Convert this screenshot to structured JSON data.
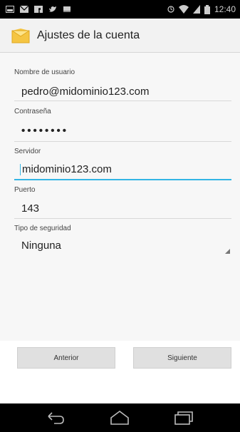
{
  "status_bar": {
    "time": "12:40",
    "icons": [
      "notification-icon",
      "gmail-icon",
      "facebook-icon",
      "twitter-icon",
      "image-icon",
      "alarm-icon",
      "wifi-icon",
      "signal-icon",
      "battery-icon"
    ]
  },
  "action_bar": {
    "title": "Ajustes de la cuenta",
    "icon": "email-app-icon"
  },
  "form": {
    "username": {
      "label": "Nombre de usuario",
      "value": "pedro@midominio123.com"
    },
    "password": {
      "label": "Contraseña",
      "value": "••••••••"
    },
    "server": {
      "label": "Servidor",
      "value": "midominio123.com"
    },
    "port": {
      "label": "Puerto",
      "value": "143"
    },
    "security": {
      "label": "Tipo de seguridad",
      "selected": "Ninguna"
    }
  },
  "buttons": {
    "previous": "Anterior",
    "next": "Siguiente"
  },
  "nav_bar": {
    "icons": [
      "back-icon",
      "home-icon",
      "recents-icon"
    ]
  },
  "colors": {
    "accent": "#33b5e5",
    "status_bar": "#000000",
    "action_bar": "#f2f2f2",
    "button": "#e0e0e0"
  }
}
